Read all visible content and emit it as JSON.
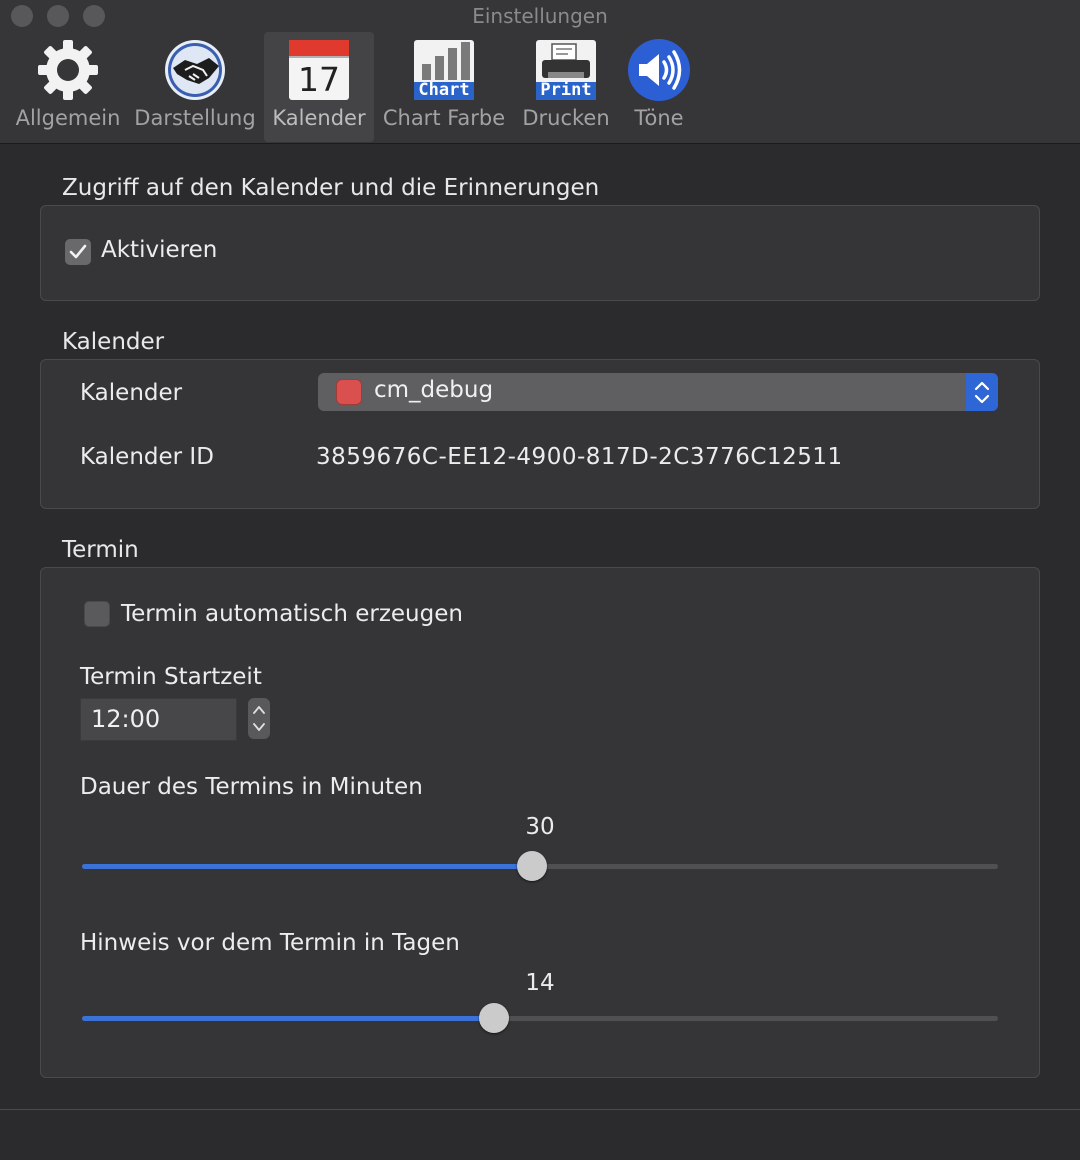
{
  "window": {
    "title": "Einstellungen"
  },
  "toolbar": {
    "items": [
      {
        "label": "Allgemein",
        "icon": "gear-icon"
      },
      {
        "label": "Darstellung",
        "icon": "handshake-icon"
      },
      {
        "label": "Kalender",
        "icon": "calendar-icon",
        "icon_text": "17",
        "selected": true
      },
      {
        "label": "Chart Farbe",
        "icon": "chart-icon",
        "icon_text": "Chart"
      },
      {
        "label": "Drucken",
        "icon": "printer-icon",
        "icon_text": "Print"
      },
      {
        "label": "Töne",
        "icon": "speaker-icon"
      }
    ]
  },
  "access": {
    "title": "Zugriff auf den Kalender und die Erinnerungen",
    "activate_label": "Aktivieren",
    "activate_checked": true
  },
  "calendar": {
    "title": "Kalender",
    "calendar_label": "Kalender",
    "calendar_value": "cm_debug",
    "calendar_color": "#d9504e",
    "id_label": "Kalender ID",
    "id_value": "3859676C-EE12-4900-817D-2C3776C12511"
  },
  "appointment": {
    "title": "Termin",
    "auto_create_label": "Termin automatisch erzeugen",
    "auto_create_checked": false,
    "start_label": "Termin Startzeit",
    "start_value": "12:00",
    "duration_label": "Dauer des Termins in Minuten",
    "duration_value": "30",
    "notice_label": "Hinweis vor dem Termin in Tagen",
    "notice_value": "14"
  },
  "colors": {
    "accent": "#3a72d8",
    "background": "#2b2b2d",
    "toolbar": "#363638"
  }
}
